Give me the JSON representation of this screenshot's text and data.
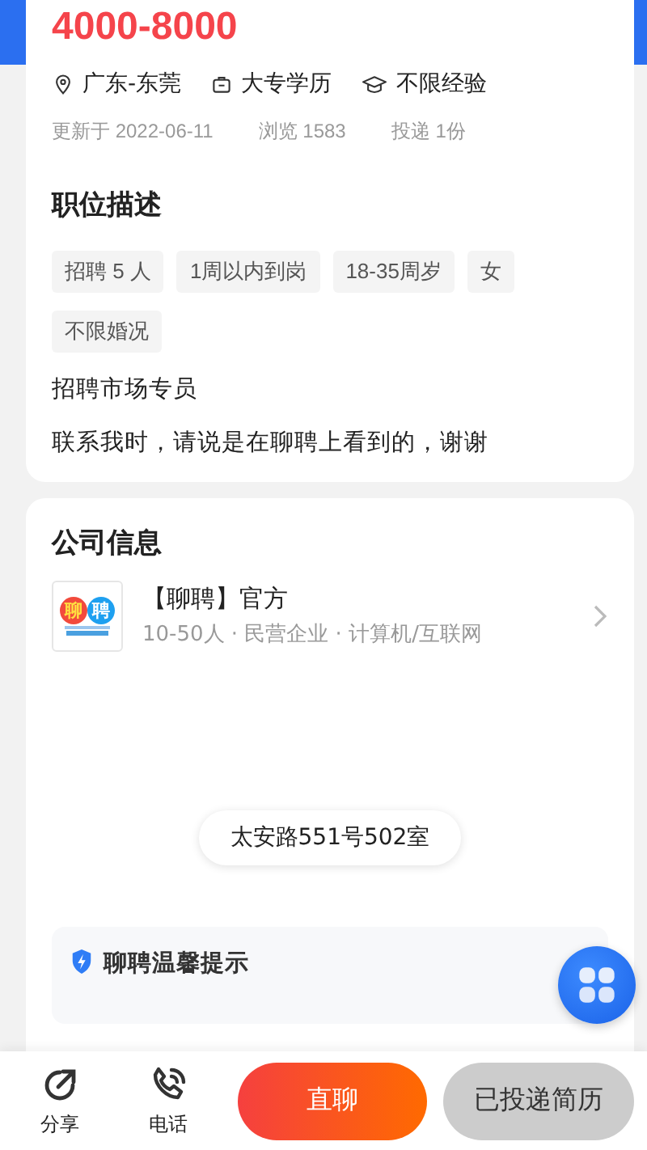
{
  "job": {
    "salary": "4000-8000",
    "location": "广东-东莞",
    "education": "大专学历",
    "experience": "不限经验",
    "updated": "更新于 2022-06-11",
    "views": "浏览 1583",
    "applications": "投递 1份"
  },
  "description": {
    "title": "职位描述",
    "tags": [
      "招聘 5 人",
      "1周以内到岗",
      "18-35周岁",
      "女",
      "不限婚况"
    ],
    "paragraphs": [
      "招聘市场专员",
      "联系我时，请说是在聊聘上看到的，谢谢"
    ]
  },
  "company": {
    "title": "公司信息",
    "logo_text": [
      "聊",
      "聘"
    ],
    "name": "【聊聘】官方",
    "details": "10-50人 · 民营企业 · 计算机/互联网",
    "address": "太安路551号502室"
  },
  "tips": {
    "title": "聊聘温馨提示"
  },
  "bottom_bar": {
    "actions": [
      {
        "kind": "share",
        "label": "分享"
      },
      {
        "kind": "phone",
        "label": "电话"
      }
    ],
    "chat_button": "直聊",
    "applied_button": {
      "label": "已投递简历",
      "disabled": true
    }
  }
}
